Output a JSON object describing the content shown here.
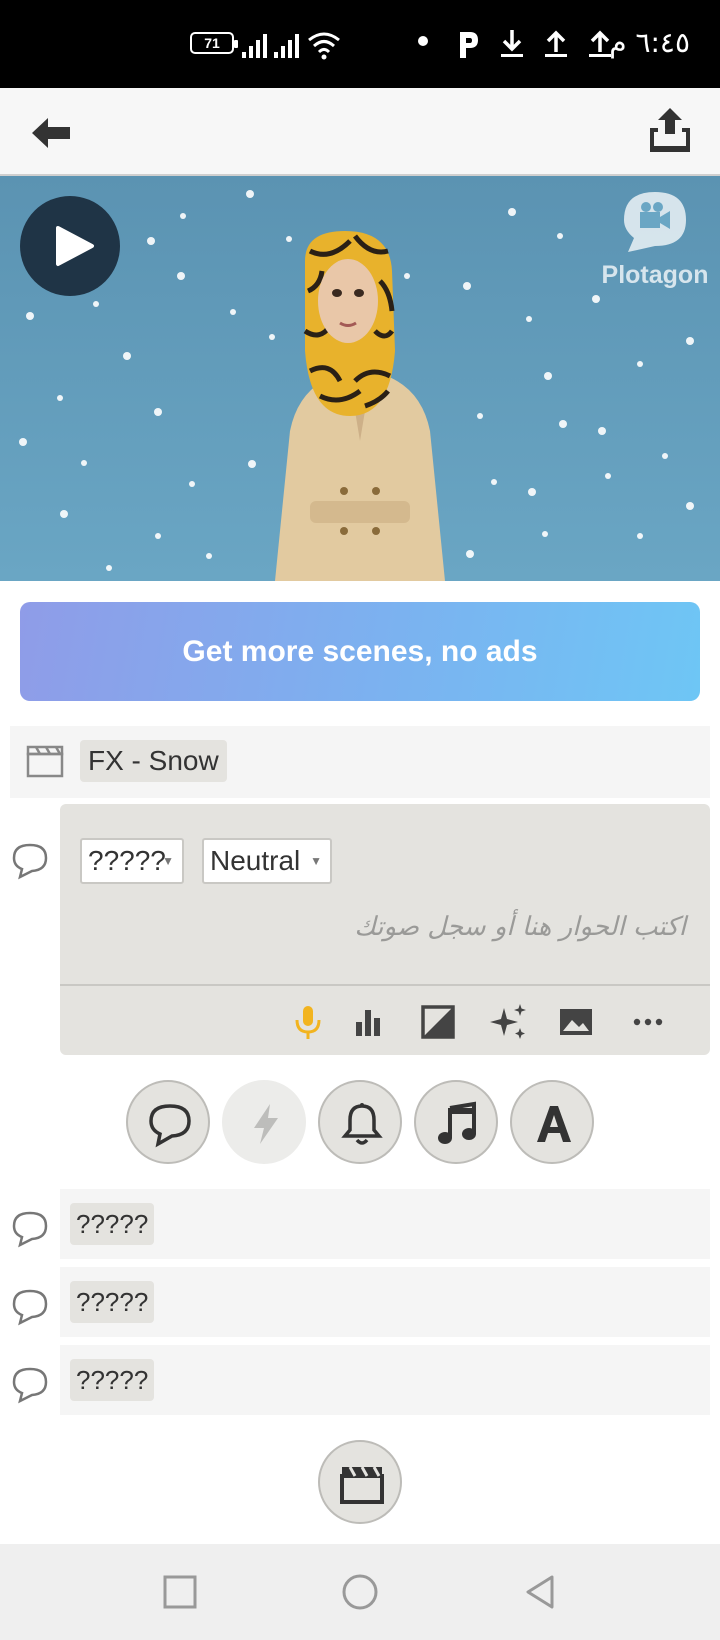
{
  "status_bar": {
    "time": "٦:٤٥ م",
    "battery": "71",
    "icons": [
      "wifi-icon",
      "signal-icon",
      "signal-icon",
      "upload-icon",
      "upload-icon",
      "download-icon",
      "parking-icon",
      "dot-icon"
    ]
  },
  "app_bar": {
    "back_icon": "arrow-left-icon",
    "share_icon": "share-upload-icon"
  },
  "scene_preview": {
    "play_icon": "play-icon",
    "watermark": "Plotagon"
  },
  "promo": {
    "label": "Get more scenes, no ads"
  },
  "fx": {
    "label": "FX - Snow",
    "icon": "clapperboard-icon"
  },
  "editor": {
    "character": "?????",
    "emotion": "Neutral",
    "placeholder": "اكتب الحوار هنا أو سجل صوتك",
    "tools": [
      "microphone-icon",
      "bar-chart-icon",
      "camera-angle-icon",
      "sparkles-icon",
      "image-icon",
      "more-icon"
    ]
  },
  "actions": [
    "dialogue-icon",
    "lightning-icon",
    "bell-icon",
    "music-icon",
    "text-icon"
  ],
  "dialogue_lines": [
    {
      "character": "?????"
    },
    {
      "character": "?????"
    },
    {
      "character": "?????"
    }
  ],
  "colors": {
    "accent_mic": "#f2b41f",
    "promo_start": "#8f9ce8",
    "promo_end": "#6ec6f5",
    "scene_bg": "#6aa6c4"
  }
}
